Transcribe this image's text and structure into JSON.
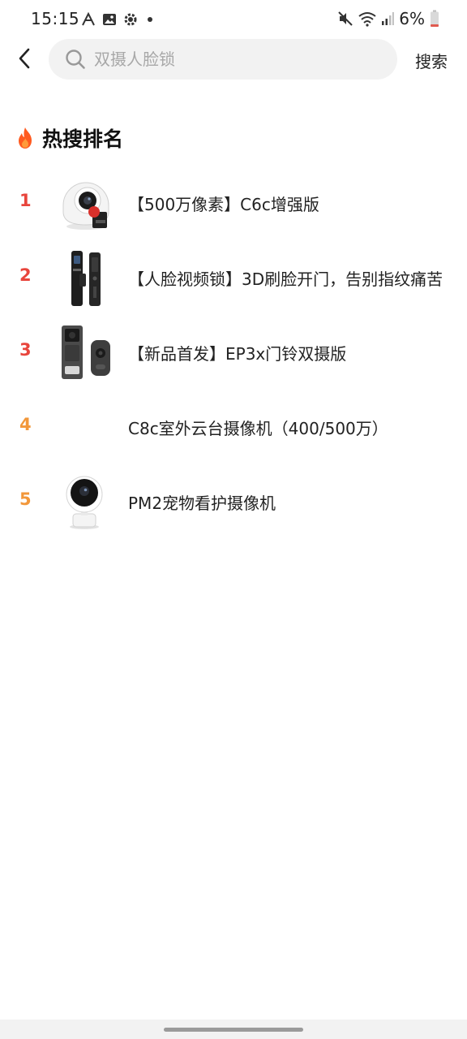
{
  "status_bar": {
    "time": "15:15",
    "battery": "6%"
  },
  "search": {
    "placeholder": "双摄人脸锁",
    "button_label": "搜索"
  },
  "section": {
    "title": "热搜排名",
    "icon": "fire-icon"
  },
  "colors": {
    "rank_top": "#e8453c",
    "rank_other": "#f2973a",
    "fire": "#ff5a1f"
  },
  "rankings": [
    {
      "rank": "1",
      "title": "【500万像素】C6c增强版",
      "thumbnail": "pan-tilt-camera"
    },
    {
      "rank": "2",
      "title": "【人脸视频锁】3D刷脸开门，告别指纹痛苦",
      "thumbnail": "smart-lock"
    },
    {
      "rank": "3",
      "title": "【新品首发】EP3x门铃双摄版",
      "thumbnail": "video-doorbell"
    },
    {
      "rank": "4",
      "title": "C8c室外云台摄像机（400/500万）",
      "thumbnail": ""
    },
    {
      "rank": "5",
      "title": "PM2宠物看护摄像机",
      "thumbnail": "pet-camera"
    }
  ]
}
